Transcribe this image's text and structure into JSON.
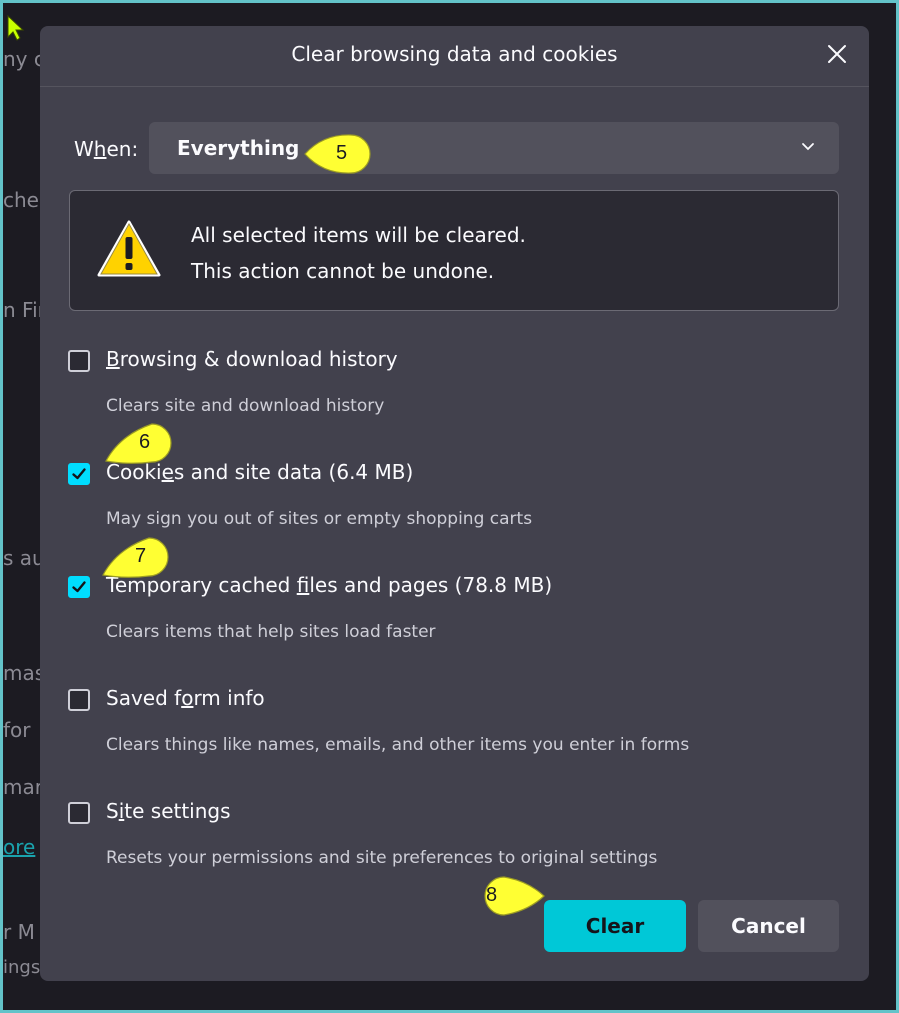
{
  "background": {
    "fragments": [
      "ny c",
      "che",
      "n Fir",
      "s au",
      "mask",
      " for",
      "mar",
      "ore",
      "r M",
      "ings"
    ]
  },
  "dialog": {
    "title": "Clear browsing data and cookies",
    "close_icon": "close-icon",
    "when": {
      "label_prefix": "W",
      "label_accel": "h",
      "label_suffix": "en:",
      "value": "Everything"
    },
    "warning": {
      "icon": "warning-icon",
      "line1": "All selected items will be cleared.",
      "line2": "This action cannot be undone."
    },
    "options": [
      {
        "label_a": "",
        "accel": "B",
        "label_b": "rowsing & download history",
        "desc": "Clears site and download history",
        "checked": false
      },
      {
        "label_a": "Cooki",
        "accel": "e",
        "label_b": "s and site data (6.4 MB)",
        "desc": "May sign you out of sites or empty shopping carts",
        "checked": true
      },
      {
        "label_a": "Temporary cached ",
        "accel": "f",
        "label_b": "iles and pages (78.8 MB)",
        "desc": "Clears items that help sites load faster",
        "checked": true
      },
      {
        "label_a": "Saved f",
        "accel": "o",
        "label_b": "rm info",
        "desc": "Clears things like names, emails, and other items you enter in forms",
        "checked": false
      },
      {
        "label_a": "S",
        "accel": "i",
        "label_b": "te settings",
        "desc": "Resets your permissions and site preferences to original settings",
        "checked": false
      }
    ],
    "buttons": {
      "clear": "Clear",
      "cancel": "Cancel"
    }
  },
  "callouts": [
    "5",
    "6",
    "7",
    "8"
  ],
  "colors": {
    "accent": "#00ddff",
    "clear_button": "#00c8d7",
    "dialog_bg": "#42414d",
    "callout_fill": "#ffff33"
  }
}
